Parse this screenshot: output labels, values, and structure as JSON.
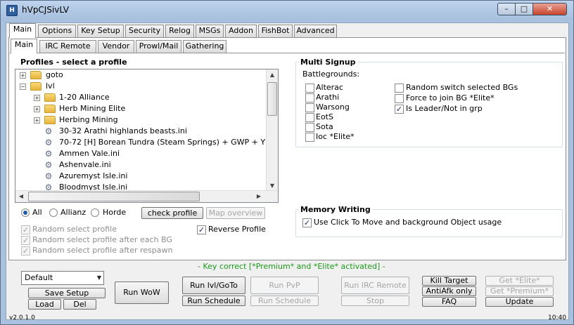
{
  "window": {
    "title": "hVpCJSivLV",
    "icon": "app-icon",
    "min_label": "–",
    "max_label": "□",
    "close_label": "✕"
  },
  "tabs_top": [
    "Main",
    "Options",
    "Key Setup",
    "Security",
    "Relog",
    "MSGs",
    "Addon",
    "FishBot",
    "Advanced"
  ],
  "tabs_sub": [
    "Main",
    "IRC Remote",
    "Vendor",
    "Prowl/Mail",
    "Gathering"
  ],
  "profiles": {
    "title": "Profiles - select a profile",
    "tree": [
      {
        "label": "goto",
        "type": "folder"
      },
      {
        "label": "lvl",
        "type": "folder"
      },
      {
        "label": "1-20 Alliance",
        "type": "folder"
      },
      {
        "label": "Herb Mining Elite",
        "type": "folder"
      },
      {
        "label": "Herbing Mining",
        "type": "folder"
      },
      {
        "label": "30-32 Arathi highlands beasts.ini",
        "type": "file"
      },
      {
        "label": "70-72 [H] Borean Tundra (Steam Springs) + GWP + Y",
        "type": "file"
      },
      {
        "label": "Ammen Vale.ini",
        "type": "file"
      },
      {
        "label": "Ashenvale.ini",
        "type": "file"
      },
      {
        "label": "Azuremyst Isle.ini",
        "type": "file"
      },
      {
        "label": "Bloodmyst Isle.ini",
        "type": "file"
      }
    ],
    "filter": {
      "all": "All",
      "allianz": "Allianz",
      "horde": "Horde",
      "selected": "All"
    },
    "check_profile": "check profile",
    "map_overview": "Map overview",
    "random_select": "Random select profile",
    "random_after_bg": "Random select profile after each BG",
    "random_after_respawn": "Random select profile after respawn",
    "reverse_profile": "Reverse Profile"
  },
  "multi_signup": {
    "title": "Multi Signup",
    "bg_label": "Battlegrounds:",
    "bgs": [
      {
        "label": "Alterac",
        "checked": false
      },
      {
        "label": "Arathi",
        "checked": false
      },
      {
        "label": "Warsong",
        "checked": false
      },
      {
        "label": "EotS",
        "checked": false
      },
      {
        "label": "Sota",
        "checked": false
      },
      {
        "label": "Ioc *Elite*",
        "checked": false
      }
    ],
    "opts": [
      {
        "label": "Random switch selected BGs",
        "checked": false
      },
      {
        "label": "Force to join BG *Elite*",
        "checked": false
      },
      {
        "label": "Is Leader/Not in grp",
        "checked": true
      }
    ]
  },
  "memory": {
    "title": "Memory Writing",
    "click_to_move": "Use Click To Move and background Object usage"
  },
  "bottom": {
    "key_status": "- Key correct  [*Premium* and *Elite* activated] -",
    "profile_combo": "Default",
    "save_setup": "Save Setup",
    "load": "Load",
    "del": "Del",
    "run_wow": "Run WoW",
    "run_lvl": "Run lvl/GoTo",
    "run_pvp": "Run PvP",
    "run_schedule": "Run Schedule",
    "run_schedule2": "Run Schedule",
    "run_irc": "Run IRC Remote",
    "stop": "Stop",
    "kill_target": "Kill Target",
    "antiafk": "AntiAfk only",
    "faq": "FAQ",
    "get_elite": "Get *Elite*",
    "get_premium": "Get *Premium*",
    "update": "Update",
    "version": "v2.0.1.0",
    "clock": "10:40"
  }
}
